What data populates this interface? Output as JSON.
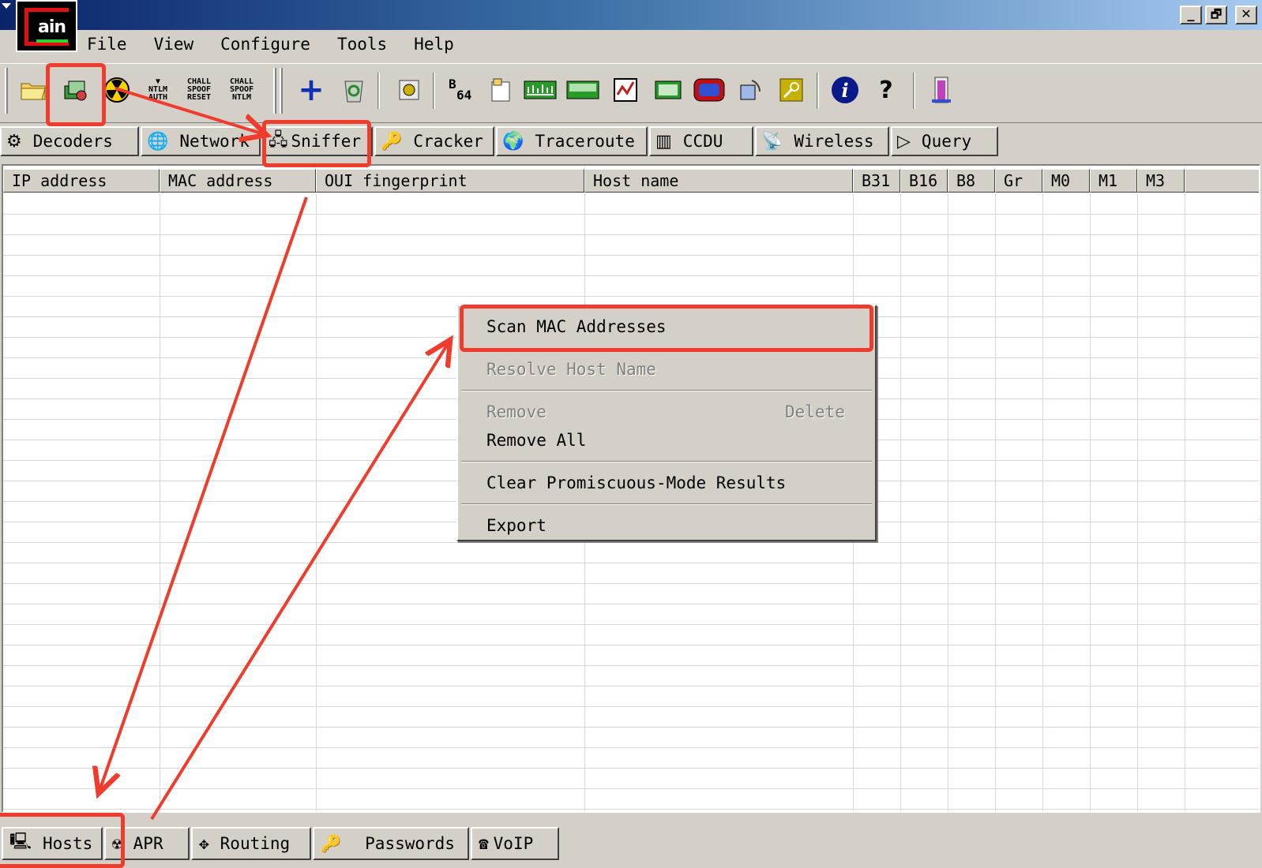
{
  "window": {
    "logo_text": "ain",
    "controls": {
      "minimize": "_",
      "maximize": "🗗",
      "close": "✕"
    }
  },
  "menu": [
    "File",
    "View",
    "Configure",
    "Tools",
    "Help"
  ],
  "toolbar": {
    "ntlm_auth": [
      "NTLM",
      "AUTH"
    ],
    "chall_spoof_reset": [
      "CHALL",
      "SPOOF",
      "RESET"
    ],
    "chall_spoof_ntlm": [
      "CHALL",
      "SPOOF",
      "NTLM"
    ],
    "base64": [
      "B",
      "64"
    ]
  },
  "tabs": [
    "Decoders",
    "Network",
    "Sniffer",
    "Cracker",
    "Traceroute",
    "CCDU",
    "Wireless",
    "Query"
  ],
  "columns": [
    "IP address",
    "MAC address",
    "OUI fingerprint",
    "Host name",
    "B31",
    "B16",
    "B8",
    "Gr",
    "M0",
    "M1",
    "M3"
  ],
  "context_menu": {
    "scan": "Scan MAC Addresses",
    "resolve": "Resolve Host Name",
    "remove": "Remove",
    "remove_shortcut": "Delete",
    "remove_all": "Remove All",
    "clear": "Clear Promiscuous-Mode Results",
    "export": "Export"
  },
  "bottom_tabs": [
    "Hosts",
    "APR",
    "Routing",
    "Passwords",
    "VoIP"
  ],
  "colors": {
    "annotation": "#f03c2c",
    "title_start": "#0a246a",
    "title_end": "#a6caf0"
  }
}
